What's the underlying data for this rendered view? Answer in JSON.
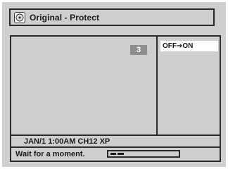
{
  "header": {
    "title": "Original - Protect",
    "icon": "disc-icon"
  },
  "preview": {
    "title_number": "3"
  },
  "options": {
    "protect_toggle": "OFF➔ON"
  },
  "info": {
    "recording_info": "JAN/1 1:00AM CH12 XP"
  },
  "status": {
    "message": "Wait for a moment.",
    "progress_fraction": 0.18
  },
  "colors": {
    "background": "#cfcfcf",
    "border": "#2a2a2a",
    "highlight": "#ffffff",
    "number_badge": "#8e8e8e"
  }
}
